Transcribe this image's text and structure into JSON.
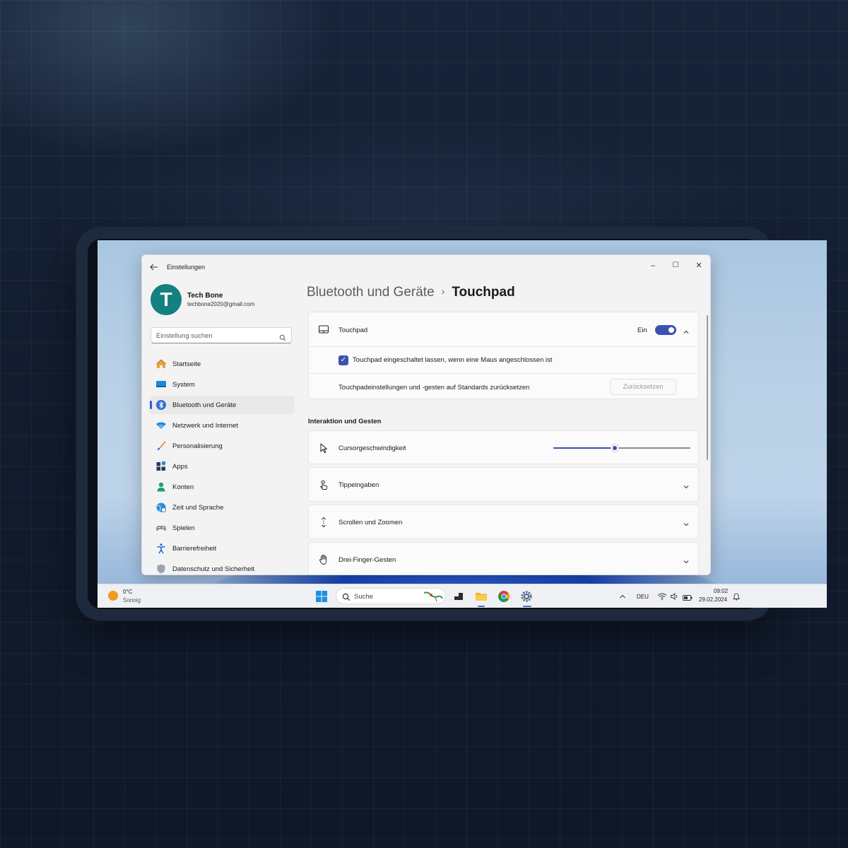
{
  "window": {
    "app_title": "Einstellungen",
    "controls": {
      "minimize": "–",
      "maximize": "☐",
      "close": "✕"
    }
  },
  "profile": {
    "initial": "T",
    "name": "Tech Bone",
    "email": "techbone2020@gmail.com"
  },
  "search": {
    "placeholder": "Einstellung suchen"
  },
  "sidebar": {
    "items": [
      {
        "label": "Startseite",
        "icon": "home-icon"
      },
      {
        "label": "System",
        "icon": "display-icon"
      },
      {
        "label": "Bluetooth und Geräte",
        "icon": "bluetooth-icon",
        "active": true
      },
      {
        "label": "Netzwerk und Internet",
        "icon": "wifi-icon"
      },
      {
        "label": "Personalisierung",
        "icon": "brush-icon"
      },
      {
        "label": "Apps",
        "icon": "apps-icon"
      },
      {
        "label": "Konten",
        "icon": "user-icon"
      },
      {
        "label": "Zeit und Sprache",
        "icon": "globe-clock-icon"
      },
      {
        "label": "Spielen",
        "icon": "gamepad-icon"
      },
      {
        "label": "Barrierefreiheit",
        "icon": "accessibility-icon"
      },
      {
        "label": "Datenschutz und Sicherheit",
        "icon": "shield-icon"
      }
    ]
  },
  "breadcrumb": {
    "parent": "Bluetooth und Geräte",
    "separator": "›",
    "current": "Touchpad"
  },
  "touchpad_card": {
    "title": "Touchpad",
    "toggle_state": "Ein",
    "toggle_on": true,
    "keep_on_label": "Touchpad eingeschaltet lassen, wenn eine Maus angeschlossen ist",
    "keep_on_checked": true,
    "reset_label": "Touchpadeinstellungen und -gesten auf Standards zurücksetzen",
    "reset_button": "Zurücksetzen"
  },
  "section": {
    "title": "Interaktion und Gesten",
    "cursor_speed_label": "Cursorgeschwindigkeit",
    "cursor_speed_fraction": 0.45,
    "items": [
      {
        "label": "Tippeingaben",
        "icon": "tap-gesture-icon"
      },
      {
        "label": "Scrollen und Zoomen",
        "icon": "scroll-arrows-icon"
      },
      {
        "label": "Drei-Finger-Gesten",
        "icon": "hand-icon"
      }
    ]
  },
  "taskbar": {
    "weather_temp": "0°C",
    "weather_desc": "Sonnig",
    "search_label": "Suche",
    "language": "DEU",
    "time": "09:02",
    "date": "29.02.2024"
  },
  "colors": {
    "accent": "#3d51b0",
    "avatar": "#14807f"
  }
}
